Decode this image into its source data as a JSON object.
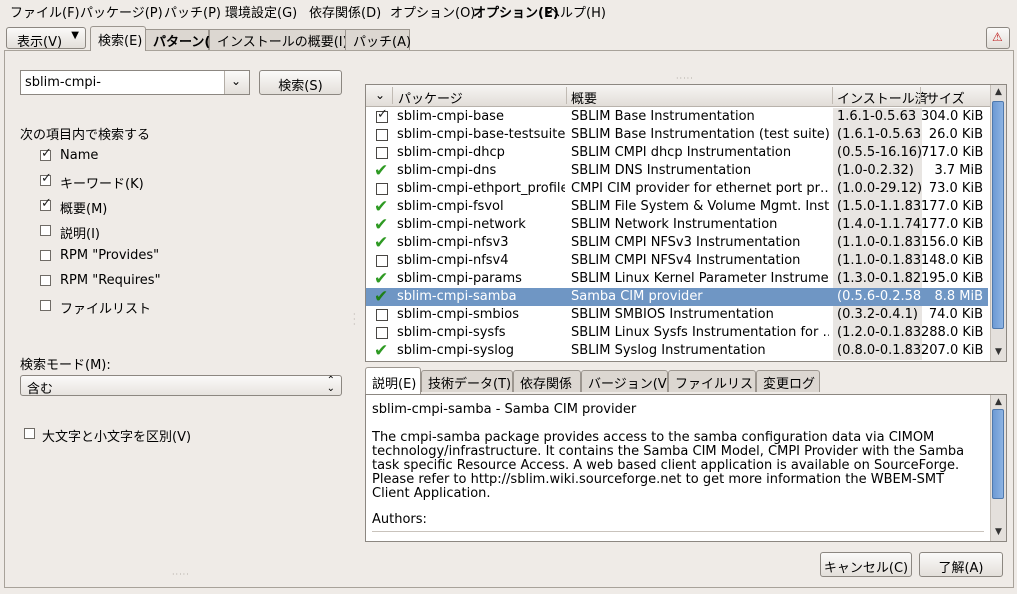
{
  "menubar": [
    "ファイル(F)",
    "パッケージ(P)",
    "パッチ(P)",
    "環境設定(G)",
    "依存関係(D)",
    "オプション(O)",
    "オプション(E)",
    "ヘルプ(H)"
  ],
  "view_button": "表示(V)",
  "main_tabs": [
    "検索(E)",
    "パターン(N)",
    "インストールの概要(I)",
    "パッチ(A)"
  ],
  "search": {
    "value": "sblim-cmpi-",
    "button": "検索(S)"
  },
  "search_in": {
    "heading": "次の項目内で検索する",
    "options": [
      {
        "label": "Name",
        "checked": true
      },
      {
        "label": "キーワード(K)",
        "checked": true
      },
      {
        "label": "概要(M)",
        "checked": true
      },
      {
        "label": "説明(I)",
        "checked": false
      },
      {
        "label": "RPM \"Provides\"",
        "checked": false
      },
      {
        "label": "RPM \"Requires\"",
        "checked": false
      },
      {
        "label": "ファイルリスト",
        "checked": false
      }
    ]
  },
  "search_mode": {
    "label": "検索モード(M):",
    "value": "含む"
  },
  "case_sensitive": {
    "label": "大文字と小文字を区別(V)",
    "checked": false
  },
  "table": {
    "columns": [
      "パッケージ",
      "概要",
      "インストール済",
      "サイズ"
    ],
    "rows": [
      {
        "status": "checked-box",
        "package": "sblim-cmpi-base",
        "summary": "SBLIM Base Instrumentation",
        "installed": "1.6.1-0.5.63",
        "size": "304.0 KiB"
      },
      {
        "status": "empty",
        "package": "sblim-cmpi-base-testsuite",
        "summary": "SBLIM Base Instrumentation (test suite)",
        "installed": "(1.6.1-0.5.63)",
        "size": "26.0 KiB"
      },
      {
        "status": "empty",
        "package": "sblim-cmpi-dhcp",
        "summary": "SBLIM CMPI dhcp Instrumentation",
        "installed": "(0.5.5-16.16)",
        "size": "717.0 KiB"
      },
      {
        "status": "installed",
        "package": "sblim-cmpi-dns",
        "summary": "SBLIM DNS Instrumentation",
        "installed": "(1.0-0.2.32)",
        "size": "3.7 MiB"
      },
      {
        "status": "empty",
        "package": "sblim-cmpi-ethport_profile",
        "summary": "CMPI CIM provider for ethernet port pr…",
        "installed": "(1.0.0-29.12)",
        "size": "73.0 KiB"
      },
      {
        "status": "installed",
        "package": "sblim-cmpi-fsvol",
        "summary": "SBLIM File System & Volume Mgmt. Inst…",
        "installed": "(1.5.0-1.1.83)",
        "size": "177.0 KiB"
      },
      {
        "status": "installed",
        "package": "sblim-cmpi-network",
        "summary": "SBLIM Network Instrumentation",
        "installed": "(1.4.0-1.1.74)",
        "size": "177.0 KiB"
      },
      {
        "status": "installed",
        "package": "sblim-cmpi-nfsv3",
        "summary": "SBLIM CMPI NFSv3 Instrumentation",
        "installed": "(1.1.0-0.1.83)",
        "size": "156.0 KiB"
      },
      {
        "status": "empty",
        "package": "sblim-cmpi-nfsv4",
        "summary": "SBLIM CMPI NFSv4 Instrumentation",
        "installed": "(1.1.0-0.1.83)",
        "size": "148.0 KiB"
      },
      {
        "status": "installed",
        "package": "sblim-cmpi-params",
        "summary": "SBLIM Linux Kernel Parameter Instrume…",
        "installed": "(1.3.0-0.1.82)",
        "size": "195.0 KiB"
      },
      {
        "status": "installed",
        "package": "sblim-cmpi-samba",
        "summary": "Samba CIM provider",
        "installed": "(0.5.6-0.2.58)",
        "size": "8.8 MiB",
        "selected": true
      },
      {
        "status": "empty",
        "package": "sblim-cmpi-smbios",
        "summary": "SBLIM SMBIOS Instrumentation",
        "installed": "(0.3.2-0.4.1)",
        "size": "74.0 KiB"
      },
      {
        "status": "empty",
        "package": "sblim-cmpi-sysfs",
        "summary": "SBLIM Linux Sysfs Instrumentation for …",
        "installed": "(1.2.0-0.1.83)",
        "size": "288.0 KiB"
      },
      {
        "status": "installed",
        "package": "sblim-cmpi-syslog",
        "summary": "SBLIM Syslog Instrumentation",
        "installed": "(0.8.0-0.1.83)",
        "size": "207.0 KiB"
      }
    ]
  },
  "detail_tabs": [
    "説明(E)",
    "技術データ(T)",
    "依存関係",
    "バージョン(V)",
    "ファイルリスト",
    "変更ログ"
  ],
  "description": {
    "title": "sblim-cmpi-samba - Samba CIM provider",
    "body": "The cmpi-samba package provides access to the samba configuration data via CIMOM technology/infrastructure. It contains the Samba CIM Model, CMPI Provider with the Samba task specific Resource Access. A web based client application is available on SourceForge. Please refer to http://sblim.wiki.sourceforge.net to get more information the WBEM-SMT Client Application.",
    "authors": "Authors:"
  },
  "buttons": {
    "cancel": "キャンセル(C)",
    "ok": "了解(A)"
  },
  "colors": {
    "selection": "#6f96c4",
    "installed_check": "#2e9a23",
    "scroll_thumb": "#7aa5dc"
  }
}
